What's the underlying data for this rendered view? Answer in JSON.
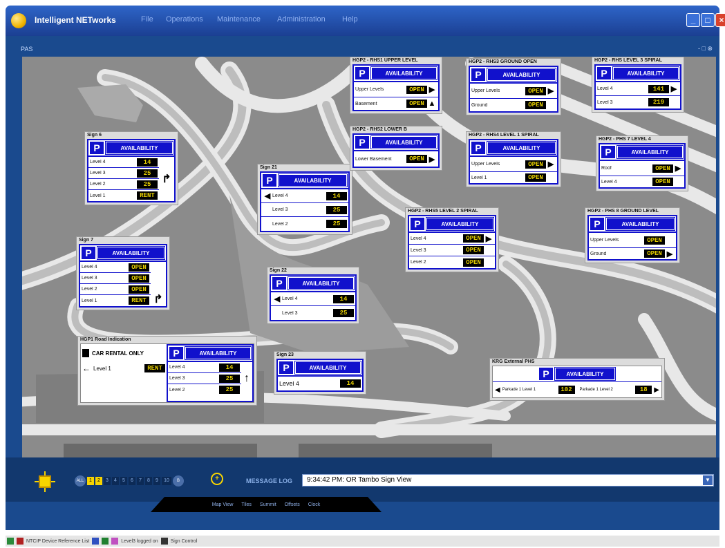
{
  "window": {
    "title": "Intelligent NETworks",
    "menu": [
      "File",
      "Operations",
      "Maintenance",
      "Administration",
      "Help"
    ],
    "controls": {
      "minimize": "_",
      "maximize": "□",
      "close": "×"
    }
  },
  "map_panel": {
    "label": "PAS",
    "close": "- □ ⊗"
  },
  "signs": [
    {
      "title": "Sign 6",
      "avail": "AVAILABILITY",
      "rows": [
        {
          "label": "Level 4",
          "value": "14"
        },
        {
          "label": "Level 3",
          "value": "25"
        },
        {
          "label": "Level 2",
          "value": "25"
        },
        {
          "label": "Level 1",
          "value": "RENT"
        }
      ]
    },
    {
      "title": "Sign 7",
      "avail": "AVAILABILITY",
      "rows": [
        {
          "label": "Level 4",
          "value": "OPEN"
        },
        {
          "label": "Level 3",
          "value": "OPEN"
        },
        {
          "label": "Level 2",
          "value": "OPEN"
        },
        {
          "label": "Level 1",
          "value": "RENT"
        }
      ]
    },
    {
      "title": "Sign 21",
      "avail": "AVAILABILITY",
      "rows": [
        {
          "label": "Level 4",
          "value": "14"
        },
        {
          "label": "Level 3",
          "value": "25"
        },
        {
          "label": "Level 2",
          "value": "25"
        }
      ]
    },
    {
      "title": "Sign 22",
      "avail": "AVAILABILITY",
      "rows": [
        {
          "label": "Level 4",
          "value": "14"
        },
        {
          "label": "Level 3",
          "value": "25"
        }
      ]
    },
    {
      "title": "Sign 23",
      "avail": "AVAILABILITY",
      "rows": [
        {
          "label": "Level 4",
          "value": "14"
        }
      ]
    },
    {
      "title": "HGP2 - RHS1 UPPER LEVEL",
      "avail": "AVAILABILITY",
      "rows": [
        {
          "label": "Upper Levels",
          "value": "OPEN"
        },
        {
          "label": "Basement",
          "value": "OPEN"
        }
      ]
    },
    {
      "title": "HGP2 - RHS2 LOWER B",
      "avail": "AVAILABILITY",
      "rows": [
        {
          "label": "Lower Basement",
          "value": "OPEN"
        }
      ]
    },
    {
      "title": "HGP2 - RHS3 GROUND OPEN",
      "avail": "AVAILABILITY",
      "rows": [
        {
          "label": "Upper Levels",
          "value": "OPEN"
        },
        {
          "label": "Ground",
          "value": "OPEN"
        }
      ]
    },
    {
      "title": "HGP2 - RHS4 LEVEL 1 SPIRAL",
      "avail": "AVAILABILITY",
      "rows": [
        {
          "label": "Upper Levels",
          "value": "OPEN"
        },
        {
          "label": "Level 1",
          "value": "OPEN"
        }
      ]
    },
    {
      "title": "HGP2 - RHS5 LEVEL 2 SPIRAL",
      "avail": "AVAILABILITY",
      "rows": [
        {
          "label": "Level 4",
          "value": "OPEN"
        },
        {
          "label": "Level 3",
          "value": "OPEN"
        },
        {
          "label": "Level 2",
          "value": "OPEN"
        }
      ]
    },
    {
      "title": "HGP2 - RHS LEVEL 3 SPIRAL",
      "avail": "AVAILABILITY",
      "rows": [
        {
          "label": "Level 4",
          "value": "141"
        },
        {
          "label": "Level 3",
          "value": "219"
        }
      ]
    },
    {
      "title": "HGP2 - PHS 7 LEVEL 4",
      "avail": "AVAILABILITY",
      "rows": [
        {
          "label": "Roof",
          "value": "OPEN"
        },
        {
          "label": "Level 4",
          "value": "OPEN"
        }
      ]
    },
    {
      "title": "HGP2 - PHS 8 GROUND LEVEL",
      "avail": "AVAILABILITY",
      "rows": [
        {
          "label": "Upper Levels",
          "value": "OPEN"
        },
        {
          "label": "Ground",
          "value": "OPEN"
        }
      ]
    }
  ],
  "hgp1": {
    "title": "HGP1 Road Indication",
    "rental": "CAR RENTAL ONLY",
    "rental_level": "Level 1",
    "rental_value": "RENT",
    "avail": "AVAILABILITY",
    "rows": [
      {
        "label": "Level 4",
        "value": "14"
      },
      {
        "label": "Level 3",
        "value": "25"
      },
      {
        "label": "Level 2",
        "value": "25"
      }
    ]
  },
  "external": {
    "title": "KRG External PHS",
    "avail": "AVAILABILITY",
    "left_label": "Parkade 1 Level 1",
    "left_value": "102",
    "right_label": "Parkade 1 Level 2",
    "right_value": "18"
  },
  "levels": [
    "ALL",
    "1",
    "2",
    "3",
    "4",
    "5",
    "6",
    "7",
    "8",
    "9",
    "10",
    "B"
  ],
  "message": {
    "label": "MESSAGE LOG",
    "text": "9:34:42 PM: OR Tambo Sign View"
  },
  "tabs": [
    "Map View",
    "Tiles",
    "Summit",
    "Offsets",
    "Clock"
  ],
  "statusbar": [
    "NTCIP Device Reference List",
    "Level3 logged on",
    "Sign Control"
  ]
}
